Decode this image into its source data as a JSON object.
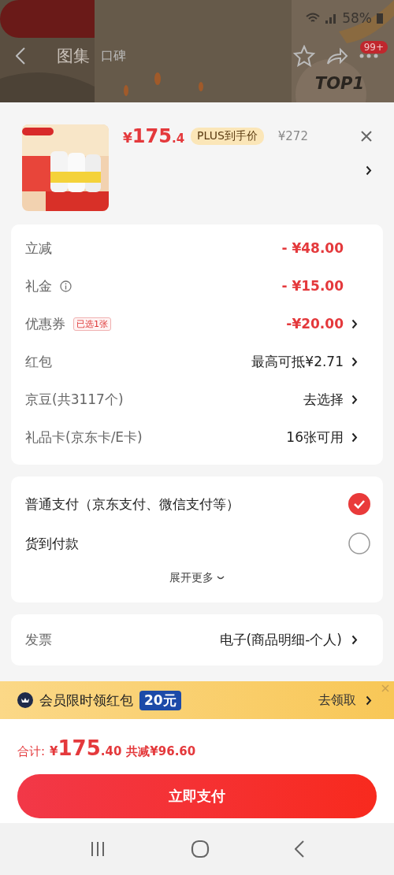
{
  "status_bar": {
    "battery": "58%"
  },
  "top_nav": {
    "tabs": [
      {
        "label": "图集",
        "selected": true
      },
      {
        "label": "口碑",
        "selected": false
      }
    ],
    "badge": "99+",
    "banner_text": "TOP1"
  },
  "product": {
    "price_symbol": "¥",
    "price_int": "175",
    "price_dec": ".4",
    "plus_label": "PLUS到手价",
    "original_price": "¥272"
  },
  "discounts": [
    {
      "label": "立减",
      "kind": "plain",
      "value": "- ¥48.00",
      "highlight": true,
      "chevron": false
    },
    {
      "label": "礼金",
      "kind": "info",
      "value": "- ¥15.00",
      "highlight": true,
      "chevron": false
    },
    {
      "label": "优惠券",
      "kind": "tag",
      "tag": "已选1张",
      "value": "-¥20.00",
      "highlight": true,
      "chevron": true
    },
    {
      "label": "红包",
      "kind": "plain",
      "value": "最高可抵¥2.71",
      "highlight": false,
      "chevron": true
    },
    {
      "label": "京豆(共3117个)",
      "kind": "plain",
      "value": "去选择",
      "highlight": false,
      "chevron": true
    },
    {
      "label": "礼品卡(京东卡/E卡)",
      "kind": "plain",
      "value": "16张可用",
      "highlight": false,
      "chevron": true
    }
  ],
  "payment": {
    "options": [
      {
        "label": "普通支付（京东支付、微信支付等）",
        "selected": true
      },
      {
        "label": "货到付款",
        "selected": false
      }
    ],
    "expand": "展开更多"
  },
  "invoice": {
    "label": "发票",
    "value": "电子(商品明细-个人)"
  },
  "promo": {
    "title": "会员限时领红包",
    "amount": "20元",
    "action": "去领取"
  },
  "total": {
    "label": "合计:",
    "symbol": "¥",
    "int": "175",
    "dec": ".40",
    "saved": "共减¥96.60"
  },
  "pay_button": "立即支付"
}
